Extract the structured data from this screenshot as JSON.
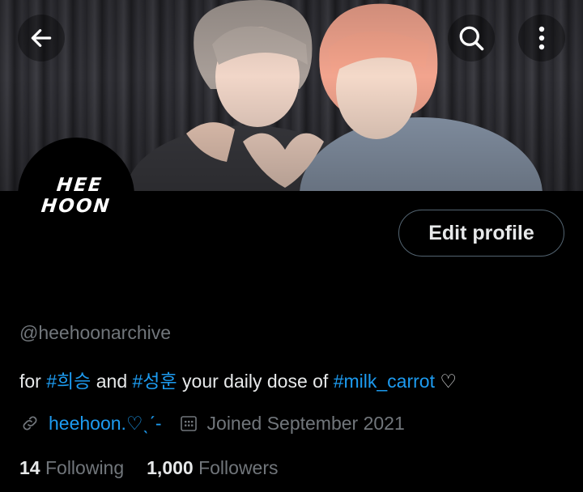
{
  "header": {
    "back_icon": "arrow-left-icon",
    "search_icon": "search-icon",
    "more_icon": "more-vertical-icon"
  },
  "banner": {
    "description_icon": "photo"
  },
  "avatar": {
    "line1": "HEE",
    "line2": "HOON"
  },
  "profile": {
    "edit_label": "Edit profile",
    "handle": "@heehoonarchive",
    "bio": {
      "t1": "for ",
      "tag1": "#희승",
      "t2": " and ",
      "tag2": "#성훈",
      "t3": " your daily dose of ",
      "tag3": "#milk_carrot",
      "t4": " ♡"
    },
    "website": "heehoon.♡ˎˊ-",
    "joined": "Joined September 2021"
  },
  "stats": {
    "following_count": "14",
    "following_label": "Following",
    "followers_count": "1,000",
    "followers_label": "Followers"
  },
  "colors": {
    "accent": "#1d9bf0",
    "muted": "#71767b",
    "text": "#e7e9ea",
    "background": "#000000"
  }
}
